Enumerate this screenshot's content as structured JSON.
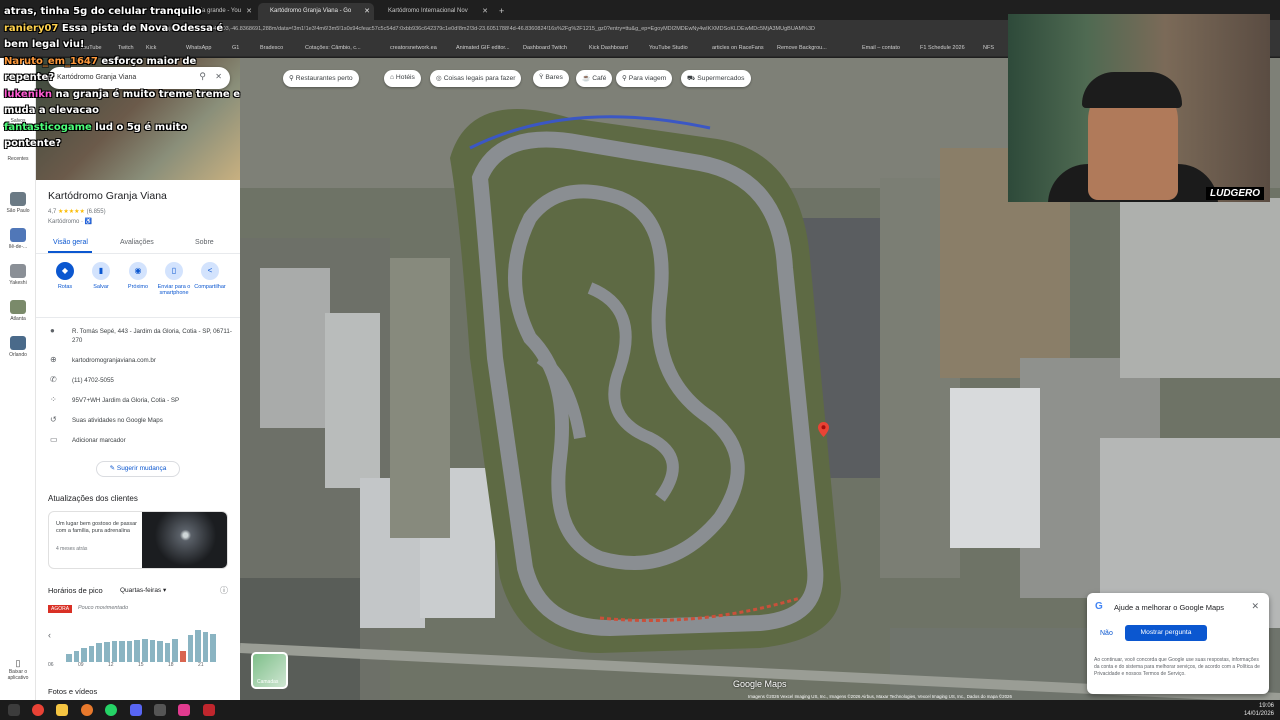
{
  "browser": {
    "tabs": [
      {
        "title": "praia grande - You",
        "active": false
      },
      {
        "title": "Kartódromo Granja Viana - Go",
        "active": true
      },
      {
        "title": "Kartódromo Internacional Nov",
        "active": false
      }
    ],
    "url": "…/Granja+Viana/@-23.6049703,-46.8368691,288m/data=!3m1!1e3!4m6!3m5!1s0x94cfeac57c5c54d7:0xbb936c642379c1e0d!8m2!3d-23.6051788!4d-46.8360824!16s%2Fg%2F1215_gz0?entry=ttu&g_ep=EgoyMDI2MDEwNy4wIKXMDSoKLDEwMDc5MjA3MUgBUAM%3D",
    "bookmarks": [
      "YouTube",
      "Twitch",
      "Kick",
      "WhatsApp",
      "G1",
      "Bradesco",
      "Cotações: Câmbio, c...",
      "creatorsnetwork.ea",
      "Animated GIF editor...",
      "Dashboard Twitch",
      "Kick Dashboard",
      "YouTube Studio",
      "articles on RaceFans",
      "Remove Backgrou...",
      "Email – contato",
      "F1 Schedule 2026",
      "NFS"
    ]
  },
  "chat": {
    "messages": [
      {
        "user": "",
        "text": "atras, tinha 5g do celular tranquilo",
        "user_color": "#ffffff"
      },
      {
        "user": "raniery07",
        "text": "Essa pista de Nova Odessa é bem legal viu!",
        "user_color": "#ffd24d"
      },
      {
        "user": "Naruto_em_1647",
        "text": "esforço maior de repente?",
        "user_color": "#ff9a3c"
      },
      {
        "user": "lukenikn",
        "text": "na granja é muito treme treme e muda a elevacao",
        "user_color": "#ff5ad2"
      },
      {
        "user": "fantasticogame",
        "text": "lud o 5g é muito pontente?",
        "user_color": "#4dff7a"
      }
    ]
  },
  "rail": {
    "items": [
      {
        "label": "Salvos"
      },
      {
        "label": "Recentes"
      },
      {
        "label": "São Paulo"
      },
      {
        "label": "Ilê-de-..."
      },
      {
        "label": "Yakeshi"
      },
      {
        "label": "Atlanta"
      },
      {
        "label": "Orlando"
      }
    ],
    "download_label": "Baixar o aplicativo"
  },
  "panel": {
    "search_value": "Kartódromo Granja Viana",
    "title": "Kartódromo Granja Viana",
    "rating": "4,7",
    "stars": "★★★★★",
    "reviews": "(6.855)",
    "category": "Kartódromo · ♿",
    "tabs": [
      "Visão geral",
      "Avaliações",
      "Sobre"
    ],
    "actions": [
      {
        "label": "Rotas",
        "icon": "◆"
      },
      {
        "label": "Salvar",
        "icon": "▮"
      },
      {
        "label": "Próximo",
        "icon": "◉"
      },
      {
        "label": "Enviar para o smartphone",
        "icon": "▯"
      },
      {
        "label": "Compartilhar",
        "icon": "<"
      }
    ],
    "info": [
      {
        "icon": "●",
        "text": "R. Tomás Sepé, 443 - Jardim da Gloria, Cotia - SP, 06711-270"
      },
      {
        "icon": "⊕",
        "text": "kartodromogranjaviana.com.br"
      },
      {
        "icon": "✆",
        "text": "(11) 4702-5055"
      },
      {
        "icon": "⁘",
        "text": "95V7+WH Jardim da Gloria, Cotia - SP"
      },
      {
        "icon": "↺",
        "text": "Suas atividades no Google Maps"
      },
      {
        "icon": "▭",
        "text": "Adicionar marcador"
      }
    ],
    "suggest": "✎ Sugerir mudança",
    "updates_title": "Atualizações dos clientes",
    "update_card": {
      "text": "Um lugar bem gostoso de passar com a família, pura adrenalina",
      "date": "4 meses atrás"
    },
    "peak_title": "Horários de pico",
    "peak_day": "Quartas-feiras ▾",
    "now_badge": "AGORA",
    "now_status": "Pouco movimentado",
    "peak_bars": [
      0.22,
      0.3,
      0.38,
      0.42,
      0.5,
      0.52,
      0.55,
      0.55,
      0.55,
      0.58,
      0.6,
      0.58,
      0.55,
      0.5,
      0.6,
      0.3,
      0.72,
      0.85,
      0.8,
      0.75
    ],
    "peak_now_index": 15,
    "peak_ticks": [
      "06",
      "09",
      "12",
      "15",
      "18",
      "21"
    ],
    "photos_title": "Fotos e vídeos"
  },
  "map": {
    "chips": [
      "Restaurantes perto",
      "Hotéis",
      "Coisas legais para fazer",
      "Bares",
      "Café",
      "Para viagem",
      "Supermercados"
    ],
    "layers_label": "Camadas",
    "google_label": "Google Maps",
    "attribution": "Imagens ©2026 Vexcel Imaging US, Inc., Imagens ©2026 Airbus, Maxar Technologies, Vexcel Imaging US, Inc., Dados do mapa ©2026"
  },
  "popup": {
    "heading": "Ajude a melhorar o Google Maps",
    "no": "Não",
    "yes": "Mostrar pergunta",
    "fine": "Ao continuar, você concorda que Google use suas respostas, informações da conta e do sistema para melhorar serviços, de acordo com a Política de Privacidade e nossos Termos de Serviço."
  },
  "camera": {
    "logo": "LUDGERO"
  },
  "clock": {
    "time": "19:06",
    "date": "14/01/2026"
  }
}
